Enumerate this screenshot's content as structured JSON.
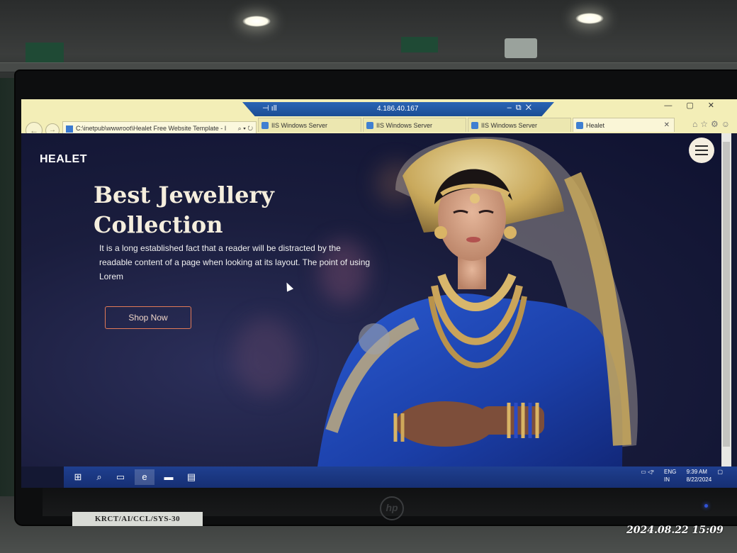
{
  "photo": {
    "timestamp": "2024.08.22 15:09",
    "asset_label": "KRCT/AI/CCL/SYS-30"
  },
  "remote_session": {
    "host": "4.186.40.167"
  },
  "browser": {
    "address": "C:\\inetpub\\wwwroot\\Healet Free Website Template - I",
    "tabs": [
      {
        "label": "IIS Windows Server",
        "active": false
      },
      {
        "label": "IIS Windows Server",
        "active": false
      },
      {
        "label": "IIS Windows Server",
        "active": false
      },
      {
        "label": "Healet",
        "active": true
      }
    ]
  },
  "page": {
    "brand": "HEALET",
    "hero_title": "Best Jewellery Collection",
    "hero_description": "It is a long established fact that a reader will be distracted by the readable content of a page when looking at its layout. The point of using Lorem",
    "cta_label": "Shop Now"
  },
  "taskbar": {
    "language": "ENG",
    "region": "IN",
    "time": "9:39 AM",
    "date": "8/22/2024"
  },
  "colors": {
    "page_background": "#141833",
    "accent_button_border": "#e27a57",
    "taskbar": "#1f3f8f",
    "browser_chrome": "#f3eeb7"
  }
}
